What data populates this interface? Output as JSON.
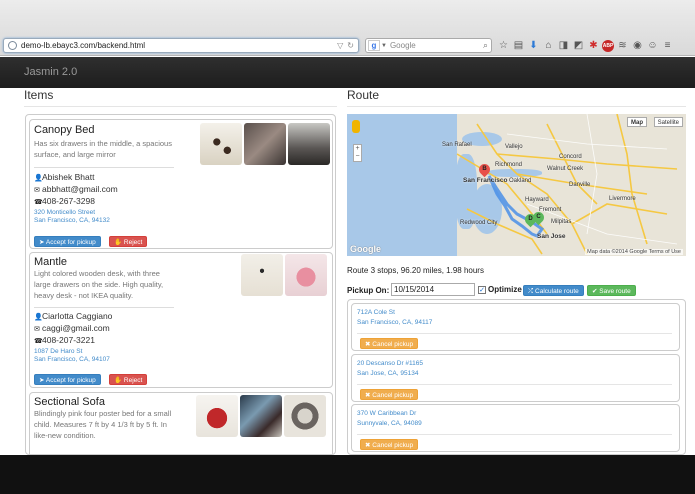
{
  "browser": {
    "url": "demo-lb.ebayc3.com/backend.html",
    "search_placeholder": "Google",
    "search_engine_letter": "g"
  },
  "app": {
    "brand": "Jasmin 2.0"
  },
  "items_section": {
    "heading": "Items",
    "cards": [
      {
        "title": "Canopy Bed",
        "description": "Has six drawers in the middle, a spacious surface, and large mirror",
        "name": "Abishek Bhatt",
        "email": "abbhatt@gmail.com",
        "phone": "408-267-3298",
        "address_line1": "320 Monticello Street",
        "address_line2": "San Francisco, CA, 94132",
        "accept_label": "Accept for pickup",
        "reject_label": "Reject"
      },
      {
        "title": "Mantle",
        "description": "Light colored wooden desk, with three large drawers on the side. High quality, heavy desk - not IKEA quality.",
        "name": "Ciarlotta Caggiano",
        "email": "caggi@gmail.com",
        "phone": "408-207-3221",
        "address_line1": "1087 De Haro St",
        "address_line2": "San Francisco, CA, 94107",
        "accept_label": "Accept for pickup",
        "reject_label": "Reject"
      },
      {
        "title": "Sectional Sofa",
        "description": "Blindingly pink four poster bed for a small child. Measures 7 ft by 4 1/3 ft by 5 ft. In like-new condition."
      }
    ]
  },
  "route_section": {
    "heading": "Route",
    "map": {
      "type_map": "Map",
      "type_satellite": "Satellite",
      "attribution": "Map data ©2014 Google  Terms of Use",
      "logo": "Google",
      "labels": {
        "san_francisco": "San Francisco",
        "san_rafael": "San Rafael",
        "richmond": "Richmond",
        "oakland": "Oakland",
        "hayward": "Hayward",
        "redwood_city": "Redwood City",
        "fremont": "Fremont",
        "san_jose": "San Jose",
        "concord": "Concord",
        "vallejo": "Vallejo",
        "walnut_creek": "Walnut Creek",
        "livermore": "Livermore",
        "danville": "Danville",
        "milpitas": "Milpitas"
      },
      "markers": [
        "B",
        "D",
        "C"
      ]
    },
    "summary": "Route 3 stops, 96.20 miles, 1.98 hours",
    "pickup_label": "Pickup On:",
    "pickup_date": "10/15/2014",
    "optimize_label": "Optimize",
    "optimize_checked": true,
    "calculate_label": "Calculate route",
    "save_label": "Save route",
    "stops": [
      {
        "line1": "712A Cole St",
        "line2": "San Francisco, CA, 94117",
        "cancel_label": "Cancel pickup"
      },
      {
        "line1": "20 Descanso Dr #1165",
        "line2": "San Jose, CA, 95134",
        "cancel_label": "Cancel pickup"
      },
      {
        "line1": "370 W Caribbean Dr",
        "line2": "Sunnyvale, CA, 94089",
        "cancel_label": "Cancel pickup"
      }
    ]
  },
  "colors": {
    "primary": "#428bca",
    "danger": "#d9534f",
    "success": "#5cb85c",
    "warning": "#f0ad4e",
    "navbar": "#222222"
  }
}
